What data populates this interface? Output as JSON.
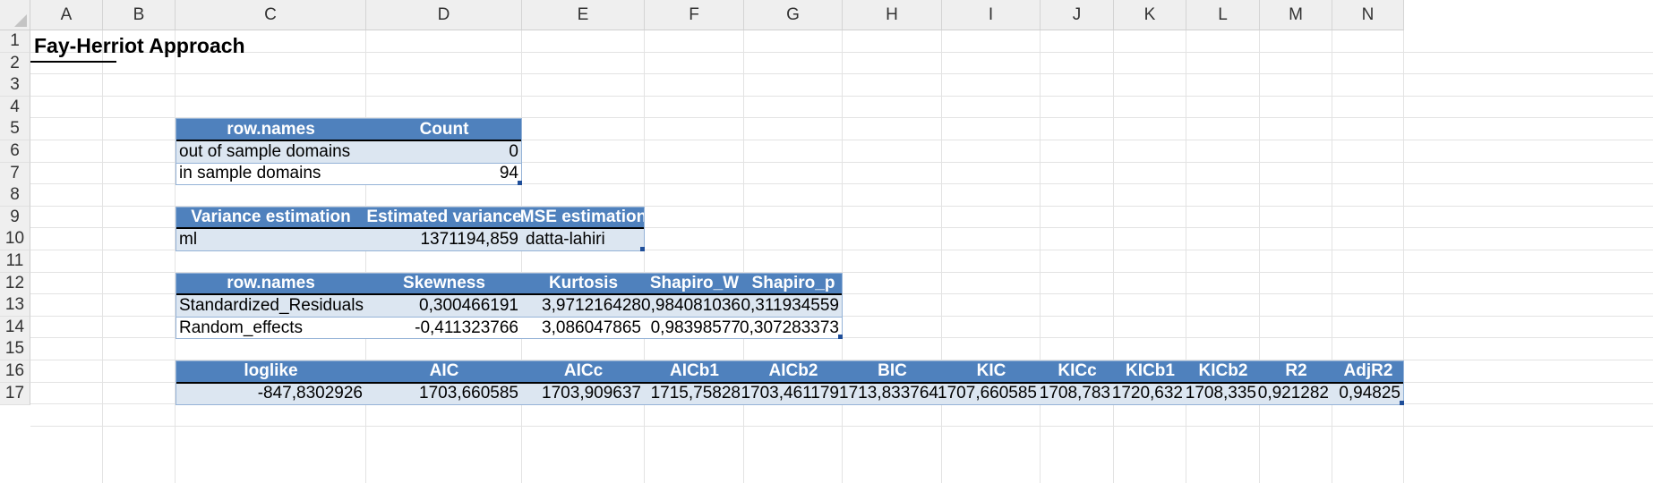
{
  "columns": [
    "A",
    "B",
    "C",
    "D",
    "E",
    "F",
    "G",
    "H",
    "I",
    "J",
    "K",
    "L",
    "M",
    "N"
  ],
  "rows": [
    "1",
    "2",
    "3",
    "4",
    "5",
    "6",
    "7",
    "8",
    "9",
    "10",
    "11",
    "12",
    "13",
    "14",
    "15",
    "16",
    "17"
  ],
  "title": "Fay-Herriot Approach",
  "table1": {
    "headers": [
      "row.names",
      "Count"
    ],
    "rows": [
      [
        "out of sample domains",
        "0"
      ],
      [
        "in sample domains",
        "94"
      ]
    ]
  },
  "table2": {
    "headers": [
      "Variance estimation",
      "Estimated variance",
      "MSE estimation"
    ],
    "rows": [
      [
        "ml",
        "1371194,859",
        "datta-lahiri"
      ]
    ]
  },
  "table3": {
    "headers": [
      "row.names",
      "Skewness",
      "Kurtosis",
      "Shapiro_W",
      "Shapiro_p"
    ],
    "rows": [
      [
        "Standardized_Residuals",
        "0,300466191",
        "3,971216428",
        "0,984081036",
        "0,311934559"
      ],
      [
        "Random_effects",
        "-0,411323766",
        "3,086047865",
        "0,98398577",
        "0,307283373"
      ]
    ]
  },
  "table4": {
    "headers": [
      "loglike",
      "AIC",
      "AICc",
      "AICb1",
      "AICb2",
      "BIC",
      "KIC",
      "KICc",
      "KICb1",
      "KICb2",
      "R2",
      "AdjR2"
    ],
    "rows": [
      [
        "-847,8302926",
        "1703,660585",
        "1703,909637",
        "1715,75828",
        "1703,461179",
        "1713,833764",
        "1707,660585",
        "1708,783",
        "1720,632",
        "1708,335",
        "0,921282",
        "0,94825"
      ]
    ]
  },
  "colors": {
    "header_fill": "#4f81bd",
    "band_fill": "#dce6f1",
    "border": "#95b3d7",
    "grid": "#e3e3e3"
  }
}
